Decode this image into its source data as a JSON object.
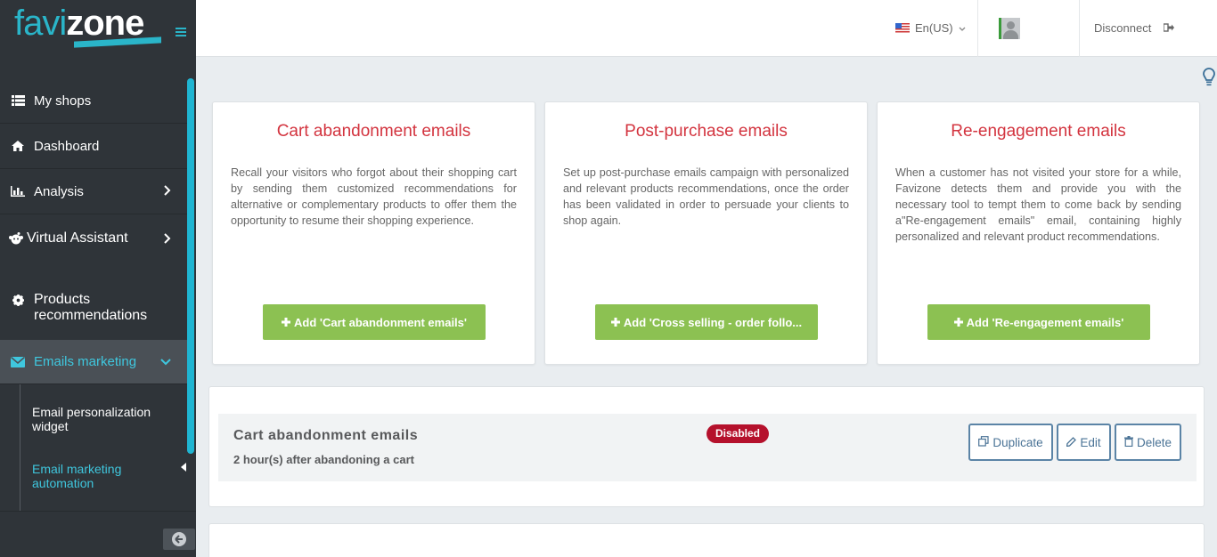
{
  "brand": {
    "logo_part1": "favi",
    "logo_part2": "zone"
  },
  "sidebar": {
    "items": [
      {
        "label": "My shops",
        "icon": "list-icon"
      },
      {
        "label": "Dashboard",
        "icon": "home-icon"
      },
      {
        "label": "Analysis",
        "icon": "bar-chart-icon"
      },
      {
        "label": "Virtual Assistant",
        "icon": "robot-icon"
      },
      {
        "label": "Products recommendations",
        "icon": "gear-icon"
      },
      {
        "label": "Emails marketing",
        "icon": "envelope-icon"
      }
    ],
    "sub_items": [
      {
        "label": "Email personalization widget"
      },
      {
        "label": "Email marketing automation"
      }
    ]
  },
  "topbar": {
    "language": "En(US)",
    "disconnect_label": "Disconnect"
  },
  "cards": [
    {
      "title": "Cart abandonment emails",
      "description": "Recall your visitors who forgot about their shopping cart by sending them customized recommendations for alternative or complementary products to offer them the opportunity to resume their shopping experience.",
      "button": "Add 'Cart abandonment emails'"
    },
    {
      "title": "Post-purchase emails",
      "description": "Set up post-purchase emails campaign with personalized and relevant products recommendations, once the order has been validated in order to persuade your clients to shop again.",
      "button": "Add 'Cross selling - order follo..."
    },
    {
      "title": "Re-engagement emails",
      "description": "When a customer has not visited your store for a while, Favizone detects them and provide you with the necessary tool to tempt them to come back by sending a\"Re-engagement emails\" email, containing highly personalized and relevant product recommendations.",
      "button": "Add 'Re-engagement emails'"
    }
  ],
  "campaigns": [
    {
      "title": "Cart abandonment emails",
      "subtitle": "2 hour(s) after abandoning a cart",
      "status": "Disabled",
      "actions": {
        "duplicate": "Duplicate",
        "edit": "Edit",
        "delete": "Delete"
      }
    }
  ],
  "colors": {
    "accent": "#2ab5c9",
    "sidebar_bg": "#2f3439",
    "card_title": "#d3343f",
    "add_button": "#8cc152",
    "badge_disabled": "#b5112c",
    "outline_button": "#5b84a6"
  }
}
